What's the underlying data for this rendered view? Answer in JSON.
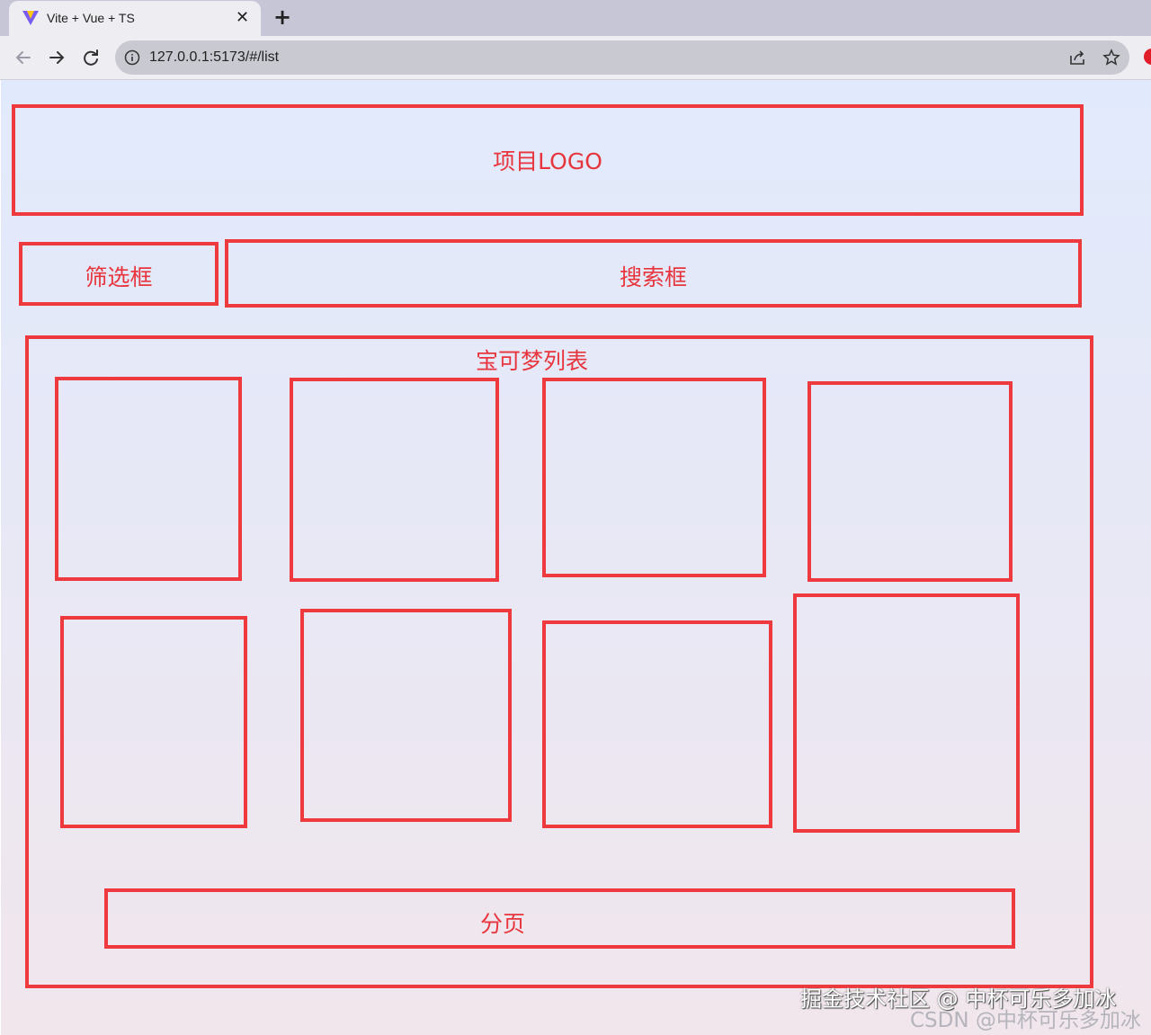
{
  "browser": {
    "tab": {
      "title": "Vite + Vue + TS",
      "close_symbol": "✕"
    },
    "new_tab_symbol": "+",
    "address_bar": {
      "url": "127.0.0.1:5173/#/list"
    },
    "icons": [
      "vite-logo-icon",
      "close-icon",
      "plus-icon",
      "back-arrow-icon",
      "forward-arrow-icon",
      "reload-icon",
      "info-icon",
      "share-icon",
      "star-icon",
      "extension-icon"
    ]
  },
  "wireframe": {
    "logo_label": "项目LOGO",
    "filter_label": "筛选框",
    "search_label": "搜索框",
    "list_label": "宝可梦列表",
    "card_count": 8,
    "pagination_label": "分页",
    "border_color": "#ee3a3e",
    "text_color": "#e8353d"
  },
  "watermarks": {
    "juejin": "掘金技术社区 @ 中杯可乐多加冰",
    "csdn": "CSDN @中杯可乐多加冰"
  }
}
